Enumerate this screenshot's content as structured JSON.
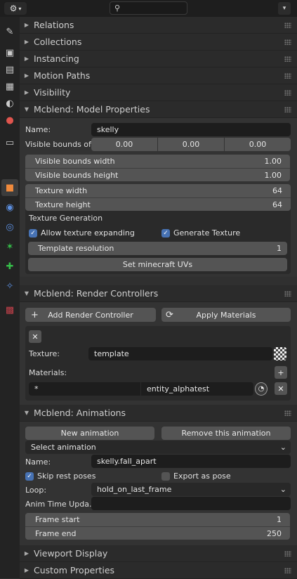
{
  "header": {
    "search_placeholder": ""
  },
  "collapsed_panels": {
    "relations": "Relations",
    "collections": "Collections",
    "instancing": "Instancing",
    "motion_paths": "Motion Paths",
    "visibility": "Visibility"
  },
  "model": {
    "title": "Mcblend: Model Properties",
    "name_label": "Name:",
    "name_value": "skelly",
    "bounds_offset_label": "Visible bounds off...",
    "offset_x": "0.00",
    "offset_y": "0.00",
    "offset_z": "0.00",
    "bounds_width_label": "Visible bounds width",
    "bounds_width": "1.00",
    "bounds_height_label": "Visible bounds height",
    "bounds_height": "1.00",
    "tex_width_label": "Texture width",
    "tex_width": "64",
    "tex_height_label": "Texture height",
    "tex_height": "64",
    "texgen_label": "Texture Generation",
    "allow_expand": "Allow texture expanding",
    "generate_tex": "Generate Texture",
    "template_res_label": "Template resolution",
    "template_res": "1",
    "set_uvs": "Set minecraft UVs"
  },
  "render": {
    "title": "Mcblend: Render Controllers",
    "add_rc": "Add Render Controller",
    "apply_mat": "Apply Materials",
    "texture_label": "Texture:",
    "texture_value": "template",
    "materials_label": "Materials:",
    "mat_pattern": "*",
    "mat_value": "entity_alphatest"
  },
  "anim": {
    "title": "Mcblend: Animations",
    "new_anim": "New animation",
    "remove_anim": "Remove this animation",
    "select_anim": "Select animation",
    "name_label": "Name:",
    "name_value": "skelly.fall_apart",
    "skip_rest": "Skip rest poses",
    "export_pose": "Export as pose",
    "loop_label": "Loop:",
    "loop_value": "hold_on_last_frame",
    "anim_time_label": "Anim Time Upda...",
    "anim_time_value": "",
    "frame_start_label": "Frame start",
    "frame_start": "1",
    "frame_end_label": "Frame end",
    "frame_end": "250"
  },
  "bottom_panels": {
    "viewport_display": "Viewport Display",
    "custom_props": "Custom Properties"
  }
}
